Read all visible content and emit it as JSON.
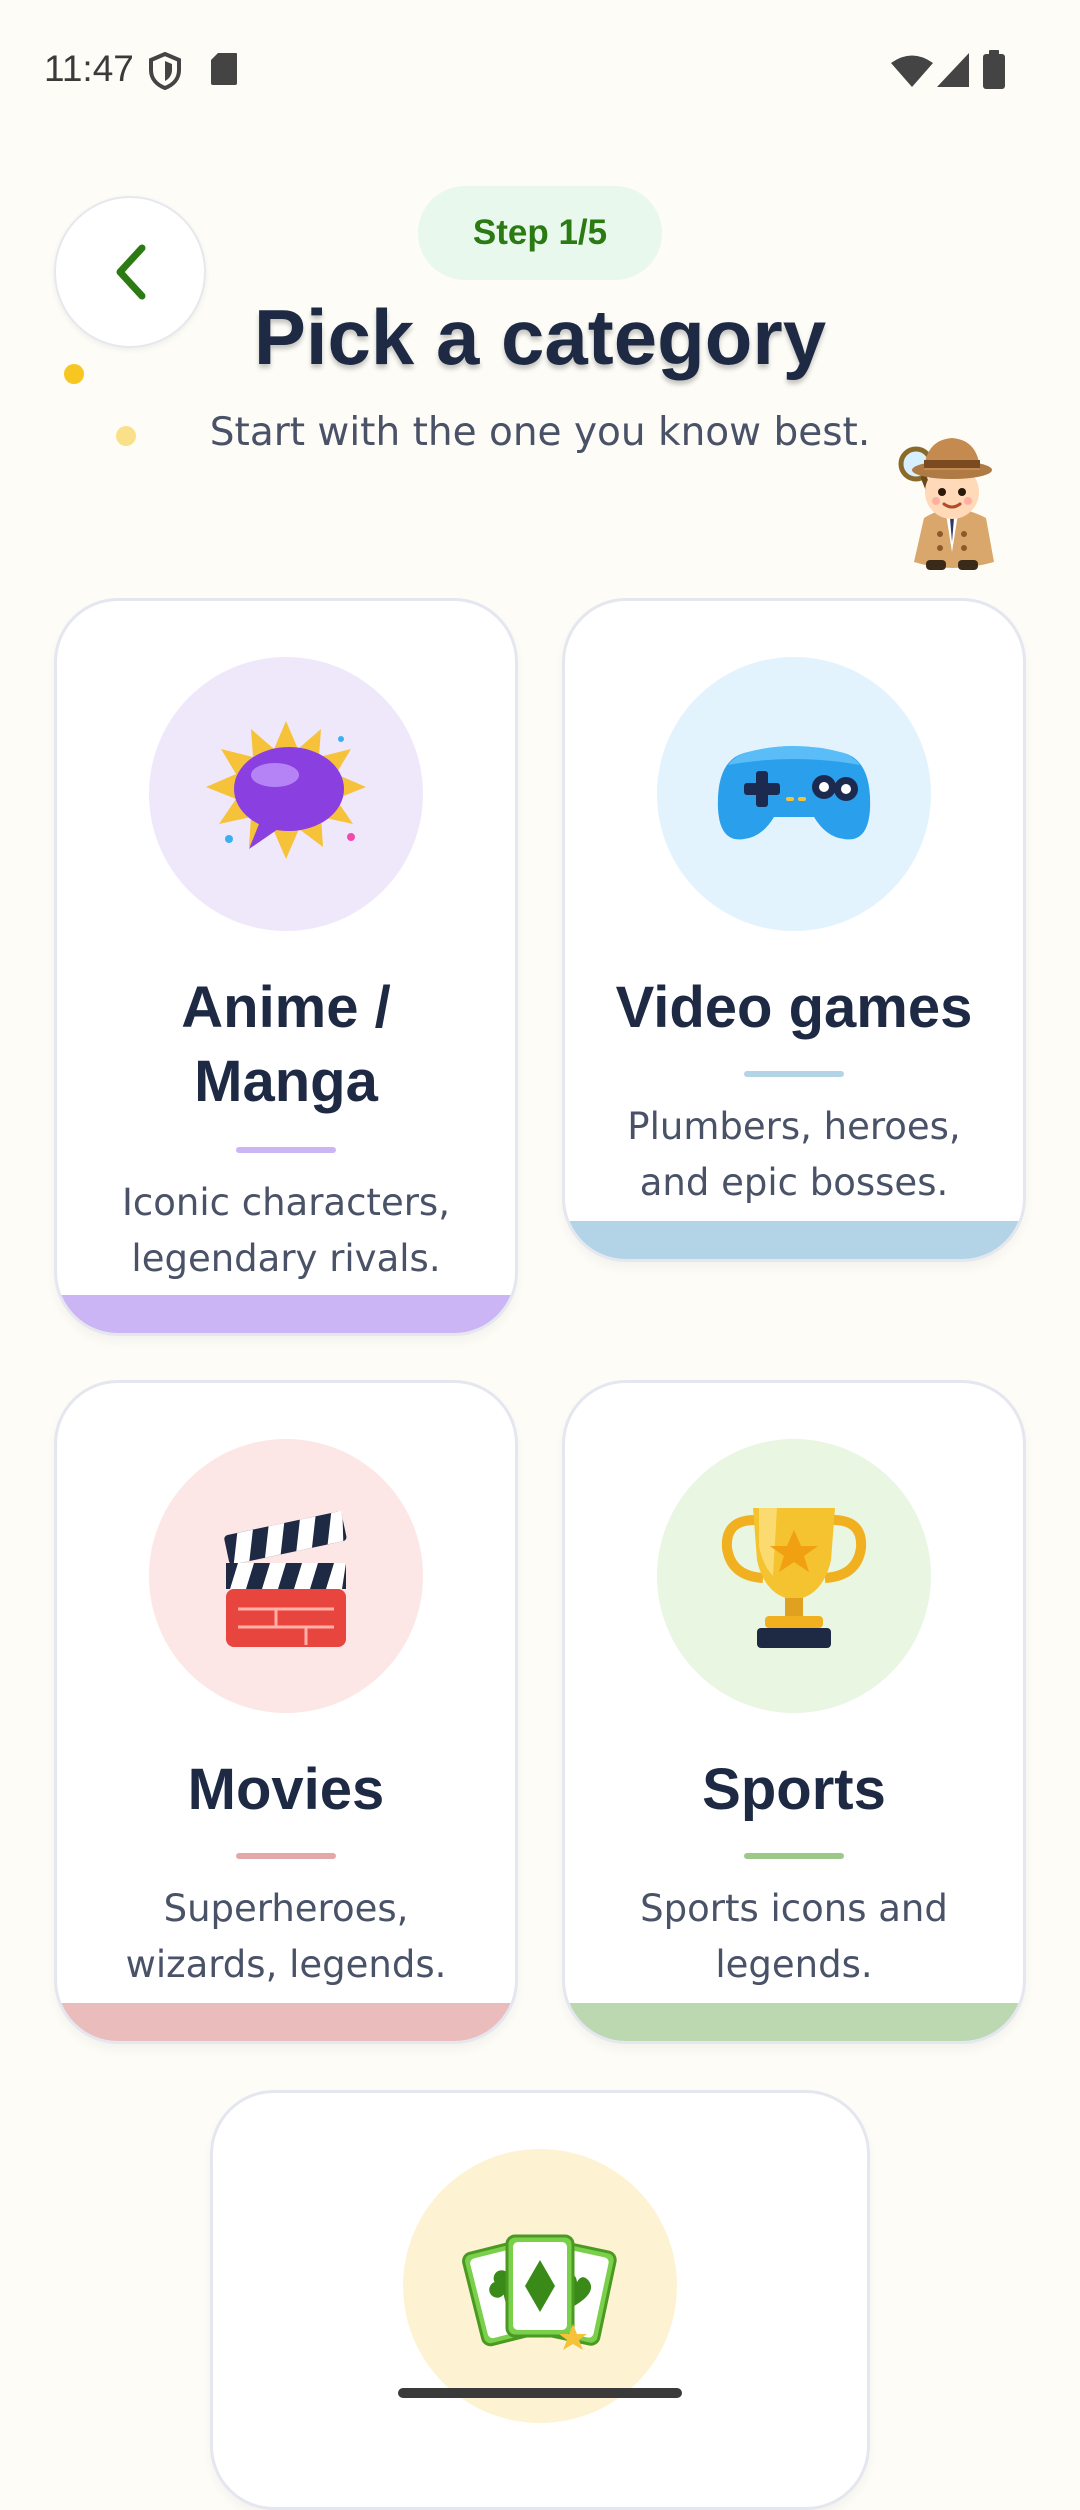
{
  "status_bar": {
    "time": "11:47",
    "icons": [
      "shield-icon",
      "sd-card-icon",
      "wifi-icon",
      "signal-icon",
      "battery-icon"
    ]
  },
  "header": {
    "back_icon": "chevron-left-icon",
    "step": "Step 1/5",
    "title": "Pick a category",
    "subtitle": "Start with the one you know best.",
    "mascot": "detective-mascot"
  },
  "colors": {
    "background": "#fdfcf7",
    "accent_green": "#2b7a13",
    "title": "#1e2a44"
  },
  "categories": [
    {
      "title": "Anime / Manga",
      "description": "Iconic characters, legendary rivals.",
      "icon": "speech-bubble-icon",
      "circle_color": "#efe8fb",
      "accent_color": "#cbb5f5"
    },
    {
      "title": "Video games",
      "description": "Plumbers, heroes, and epic bosses.",
      "icon": "gamepad-icon",
      "circle_color": "#e2f3fd",
      "accent_color": "#b3d4e6"
    },
    {
      "title": "Movies",
      "description": "Superheroes, wizards, legends.",
      "icon": "clapperboard-icon",
      "circle_color": "#fde6e6",
      "accent_color": "#ebbcbc"
    },
    {
      "title": "Sports",
      "description": "Sports icons and legends.",
      "icon": "trophy-icon",
      "circle_color": "#e8f6e2",
      "accent_color": "#bcd8b0"
    },
    {
      "title": "",
      "description": "",
      "icon": "playing-cards-icon",
      "circle_color": "#fdf3d3",
      "accent_color": "#e8d9a0"
    }
  ]
}
